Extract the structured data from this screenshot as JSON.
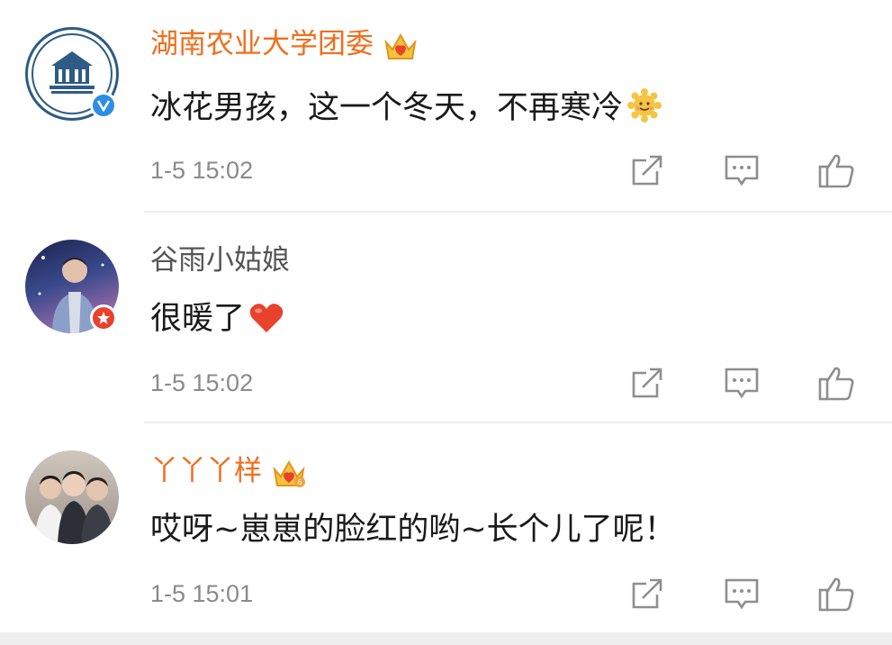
{
  "comments": [
    {
      "username": "湖南农业大学团委",
      "user_style": "vip",
      "badge": "verified-v",
      "text": "冰花男孩，这一个冬天，不再寒冷",
      "trailing_emoji": "smiling-sun-emoji",
      "time": "1-5 15:02"
    },
    {
      "username": "谷雨小姑娘",
      "user_style": "plain",
      "badge": "star-red",
      "text": "很暖了",
      "trailing_emoji": "red-heart-emoji",
      "time": "1-5 15:02"
    },
    {
      "username": "丫丫丫样",
      "user_style": "vip",
      "badge": "none",
      "text": "哎呀~崽崽的脸红的哟~长个儿了呢！",
      "trailing_emoji": "",
      "time": "1-5 15:01"
    }
  ],
  "actions": [
    "share-icon",
    "comment-icon",
    "like-icon"
  ],
  "colors": {
    "vip_name": "#f26d1b",
    "plain_name": "#555555",
    "time": "#8a8a8a",
    "icon": "#8e8e8e",
    "verified": "#2d8ee6",
    "star_badge": "#e8412c"
  }
}
